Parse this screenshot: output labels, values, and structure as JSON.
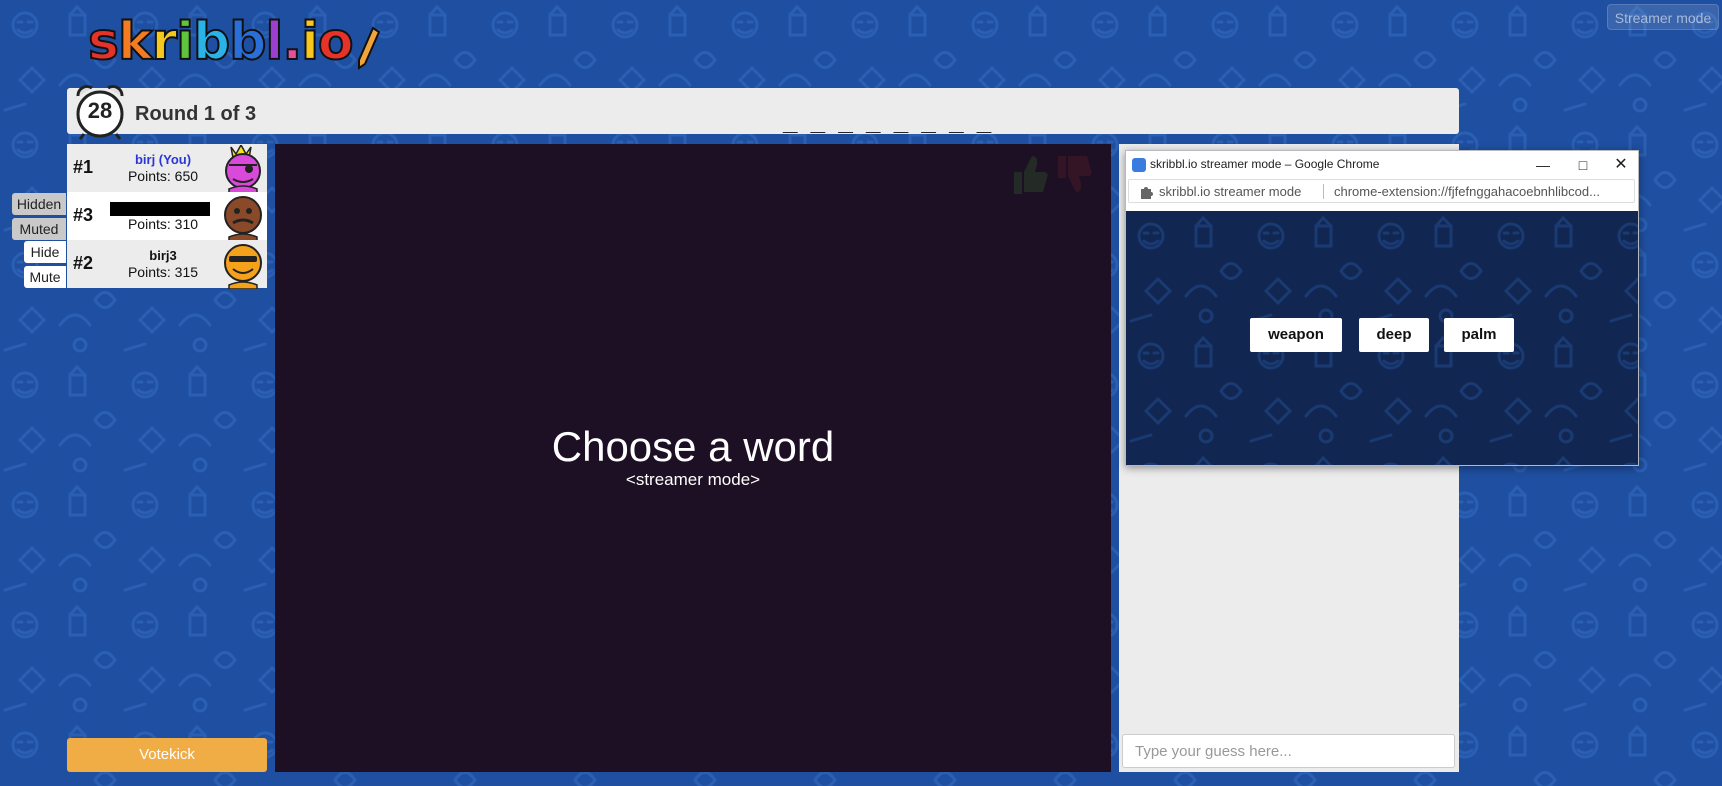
{
  "logo": {
    "letters": [
      "s",
      "k",
      "r",
      "i",
      "b",
      "b",
      "l",
      ".",
      "i",
      "o"
    ],
    "colors": [
      "#e5332a",
      "#f37b21",
      "#f6c81e",
      "#5ec53c",
      "#2bb3e8",
      "#2a6ed8",
      "#9b3fd0",
      "#e84f9a",
      "#f6c81e",
      "#e5332a"
    ]
  },
  "top": {
    "streamer_mode": "Streamer mode"
  },
  "header": {
    "timer": "28",
    "round": "Round 1 of 3",
    "word_hint": "_ _ _ _ _ _ _ _"
  },
  "players": [
    {
      "rank": "#1",
      "name": "birj (You)",
      "points": "Points: 650",
      "is_you": true,
      "avatar_color": "#d94adb",
      "crown": true
    },
    {
      "rank": "#3",
      "name": "",
      "points": "Points: 310",
      "redacted": true,
      "avatar_color": "#8a4a2a"
    },
    {
      "rank": "#2",
      "name": "birj3",
      "points": "Points: 315",
      "avatar_color": "#f4a21c"
    }
  ],
  "side_buttons": {
    "hidden": "Hidden",
    "muted": "Muted",
    "hide": "Hide",
    "mute": "Mute"
  },
  "canvas": {
    "title": "Choose a word",
    "subtitle": "<streamer mode>"
  },
  "votekick": "Votekick",
  "chat": {
    "placeholder": "Type your guess here..."
  },
  "popup": {
    "title": "skribbl.io streamer mode – Google Chrome",
    "ext_name": "skribbl.io streamer mode",
    "url": "chrome-extension://fjfefnggahacoebnhlibcod...",
    "words": [
      "weapon",
      "deep",
      "palm"
    ]
  },
  "colors": {
    "page_bg": "#1f4fa0",
    "canvas_bg": "#1d0f24",
    "popup_bg": "#112650",
    "votekick": "#f0ac45",
    "you_name": "#2a37d6"
  }
}
